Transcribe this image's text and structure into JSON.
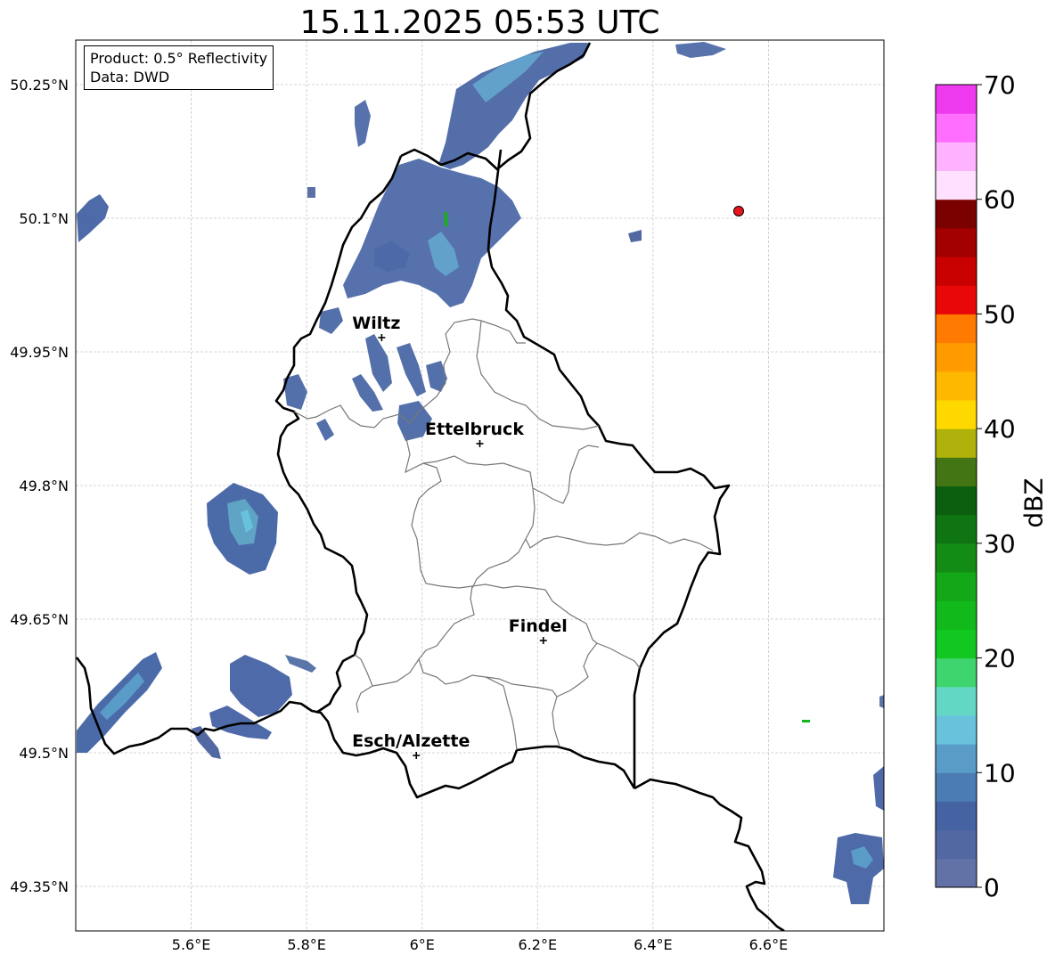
{
  "title": "15.11.2025 05:53 UTC",
  "info": {
    "product": "Product: 0.5° Reflectivity",
    "source": "Data: DWD"
  },
  "axes": {
    "x_ticks": [
      "5.6°E",
      "5.8°E",
      "6°E",
      "6.2°E",
      "6.4°E",
      "6.6°E"
    ],
    "y_ticks": [
      "50.25°N",
      "50.1°N",
      "49.95°N",
      "49.8°N",
      "49.65°N",
      "49.5°N",
      "49.35°N"
    ],
    "x_values": [
      5.6,
      5.8,
      6.0,
      6.2,
      6.4,
      6.6
    ],
    "y_values": [
      50.25,
      50.1,
      49.95,
      49.8,
      49.65,
      49.5,
      49.35
    ],
    "lon_range": [
      5.4,
      6.8
    ],
    "lat_range": [
      49.3,
      50.3
    ]
  },
  "cities": [
    {
      "name": "Wiltz",
      "lon": 5.93,
      "lat": 49.966
    },
    {
      "name": "Ettelbruck",
      "lon": 6.1,
      "lat": 49.847
    },
    {
      "name": "Findel",
      "lon": 6.21,
      "lat": 49.626
    },
    {
      "name": "Esch/Alzette",
      "lon": 5.99,
      "lat": 49.497
    }
  ],
  "colorbar": {
    "label": "dBZ",
    "ticks": [
      "0",
      "10",
      "20",
      "30",
      "40",
      "50",
      "60",
      "70"
    ],
    "min": 0,
    "max": 70,
    "step": 2.5,
    "colors": [
      "#6372a6",
      "#5268a3",
      "#4562a3",
      "#4b7cb3",
      "#5a9cc8",
      "#68c2dc",
      "#62d8c4",
      "#3ed46e",
      "#12c71f",
      "#12b91a",
      "#12a818",
      "#128c15",
      "#0f7512",
      "#0b5e0d",
      "#437514",
      "#aeb20b",
      "#ffd800",
      "#ffb800",
      "#ff9a00",
      "#ff7a00",
      "#e80808",
      "#c80000",
      "#a30000",
      "#7b0000",
      "#ffe0ff",
      "#ffb2ff",
      "#ff6eff",
      "#ee3aee"
    ]
  }
}
